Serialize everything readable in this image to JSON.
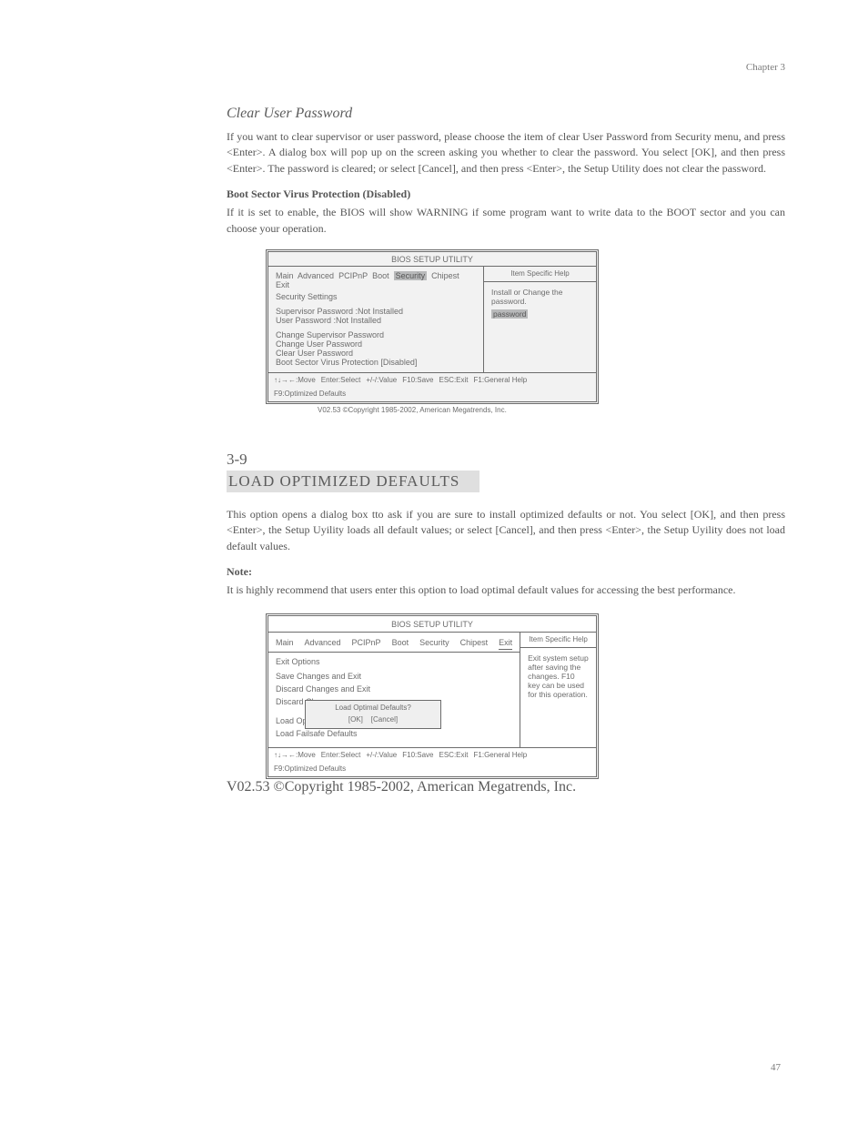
{
  "header": {
    "chapter": "Chapter 3"
  },
  "section1": {
    "title": "Clear User Password",
    "para1": "If you want to clear supervisor or user password, please choose the item of clear User Password from Security menu, and press <Enter>. A dialog box will pop up on the screen asking you whether to clear the password. You select [OK], and then press <Enter>. The password is cleared; or select [Cancel], and then press <Enter>, the Setup Utility does not clear the password.",
    "h3_1": "Boot Sector Virus Protection (Disabled)",
    "para2": "If it is set to enable, the BIOS will show WARNING if some program want to write data to the BOOT sector and you can choose your operation."
  },
  "bios1": {
    "utility_title": "BIOS SETUP UTILITY",
    "tabs": [
      "Main",
      "Advanced",
      "PCIPnP",
      "Boot",
      "Security",
      "Chipest",
      "Exit"
    ],
    "active_tab": "Security",
    "left_lines": [
      "Security Settings",
      "",
      "Supervisor Password      :Not Installed",
      "User Password            :Not Installed",
      "",
      "Change Supervisor Password",
      "Change User Password",
      "Clear User Password",
      "Boot Sector Virus Protection          [Disabled]"
    ],
    "help_pane_title": "Item Specific Help",
    "help_text": "Install or Change the password.",
    "help_highlight": "password",
    "footer_items": [
      "↑↓→←:Move",
      "Enter:Select",
      "+/-/:Value",
      "F10:Save",
      "ESC:Exit",
      "F1:General Help",
      "F9:Optimized Defaults"
    ],
    "caption": "V02.53 ©Copyright 1985-2002, American Megatrends, Inc."
  },
  "section39": {
    "number": "3-9",
    "title": "LOAD OPTIMIZED DEFAULTS",
    "para": "This option opens a dialog box tto ask if you are sure to install optimized defaults or not. You select [OK], and then press <Enter>, the Setup Uyility loads all default values; or select [Cancel], and then press <Enter>, the Setup Uyility does not load default values.",
    "note_title": "Note:",
    "note_text": "It is highly recommend that users enter this option to load optimal default values for accessing the best performance."
  },
  "bios2": {
    "utility_title": "BIOS SETUP UTILITY",
    "tabs": [
      "Main",
      "Advanced",
      "PCIPnP",
      "Boot",
      "Security",
      "Chipest",
      "Exit"
    ],
    "active_tab": "Exit",
    "menu_heading": "Exit Options",
    "menu_items": [
      "Save Changes and Exit",
      "Discard Changes and Exit",
      "Discard Changes",
      "",
      "Load Optimal Defaults",
      "Load Failsafe Defaults"
    ],
    "dialog_title": "Load Optimal Defaults?",
    "dialog_buttons": [
      "[OK]",
      "[Cancel]"
    ],
    "help_pane_title": "Item Specific Help",
    "help_text": "Exit system setup after saving the changes. F10 key can be used for this operation.",
    "footer_items": [
      "↑↓→←:Move",
      "Enter:Select",
      "+/-/:Value",
      "F10:Save",
      "ESC:Exit",
      "F1:General Help",
      "F9:Optimized Defaults"
    ],
    "caption": "V02.53 ©Copyright 1985-2002, American Megatrends, Inc."
  },
  "page_number": "47"
}
